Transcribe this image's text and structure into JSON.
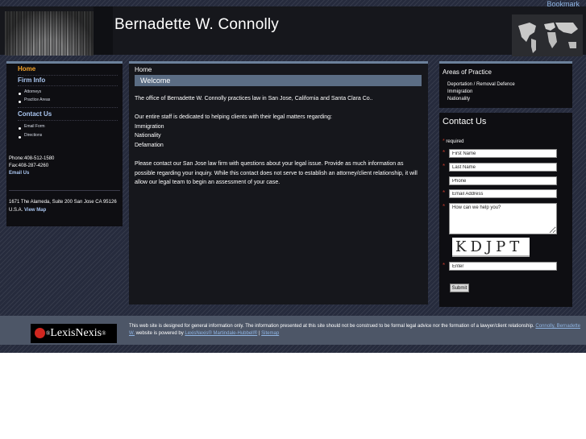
{
  "header": {
    "title": "Bernadette W. Connolly",
    "bookmark": "Bookmark"
  },
  "sidebar": {
    "items": [
      {
        "label": "Home"
      },
      {
        "label": "Firm Info",
        "sub": [
          "Attorneys",
          "Practice Areas"
        ]
      },
      {
        "label": "Contact Us",
        "sub": [
          "Email Form",
          "Directions"
        ]
      }
    ],
    "phone": "Phone:408-512-1580",
    "fax": "Fax:408-287-4260",
    "email": "Email Us",
    "address": "1671 The Alameda, Suite 200 San Jose CA 95126 U.S.A.",
    "view_map": "View Map"
  },
  "main": {
    "breadcrumb": "Home",
    "heading": "Welcome",
    "para1": "The office of Bernadette W. Connolly practices law in San Jose, California and Santa Clara Co..",
    "para2_intro": "Our entire staff is dedicated to helping clients with their legal matters regarding:",
    "para2_items": [
      "Immigration",
      "Nationality",
      "Defamation"
    ],
    "para3": "Please contact our San Jose law firm with questions about your legal issue. Provide as much information as possible regarding your inquiry. While this contact does not serve to establish an attorney/client relationship, it will allow our legal team to begin an assessment of your case."
  },
  "areas": {
    "title": "Areas of Practice",
    "items": [
      "Deportation / Removal Defence",
      "Immigration",
      "Nationality"
    ]
  },
  "contact_form": {
    "title": "Contact Us",
    "required_note": "required",
    "first_name": "First Name",
    "last_name": "Last Name",
    "phone": "Phone",
    "email": "Email Address",
    "message": "How can we help you?",
    "captcha_text": "KDJPT",
    "captcha_input": "Enter",
    "submit": "Submit"
  },
  "footer": {
    "logo_text": "LexisNexis",
    "logo_symbol": "®",
    "text": "This web site is designed for general information only. The information presented at this site should not be construed to be formal legal advice nor the formation of a lawyer/client relationship.",
    "link1": "Connolly, Bernadette W.",
    "mid": "website is powered by",
    "link2": "LexisNexis® Martindale-Hubbell®",
    "sep": "|",
    "link3": "Sitemap"
  },
  "colors": {
    "accent_orange": "#f3a22a",
    "nav_blue": "#aac6f0",
    "header_bar": "#5b6d84",
    "required_red": "#c0392b"
  }
}
